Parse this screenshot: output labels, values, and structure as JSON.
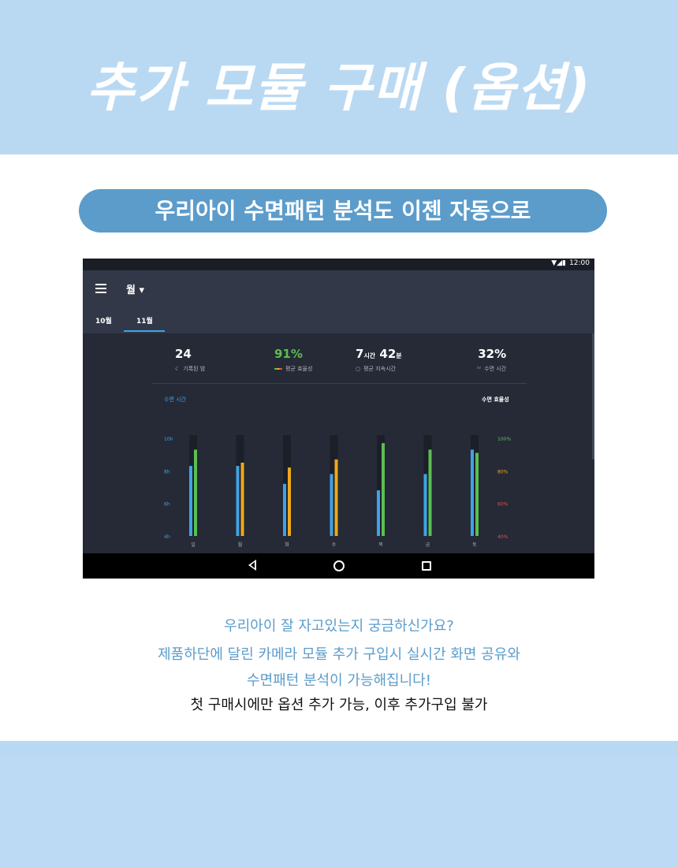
{
  "headline": "추가 모듈 구매 (옵션)",
  "banner": "우리아이 수면패턴 분석도 이젠 자동으로",
  "tablet": {
    "status_time": "12:00",
    "status_icons": "▼◢▮",
    "month_selector": "월 ▾",
    "tabs": [
      "10월",
      "11월"
    ],
    "active_tab": "11월",
    "stats": [
      {
        "value": "24",
        "label": "기록된 밤",
        "icon": "moon-icon"
      },
      {
        "value": "91%",
        "label": "평균 효율성",
        "icon": "efficiency-bar-icon"
      },
      {
        "value_main": "7",
        "unit1": "시간",
        "value_2": "42",
        "unit2": "분",
        "label": "평균 지속시간",
        "icon": "clock-icon"
      },
      {
        "value": "32%",
        "label": "수면 시간",
        "icon": "sleep-icon"
      }
    ],
    "chart_title_left": "수면 시간",
    "chart_title_right": "수면 효율성"
  },
  "chart_data": {
    "type": "bar",
    "categories": [
      "일",
      "월",
      "화",
      "수",
      "목",
      "금",
      "토"
    ],
    "left_axis": {
      "ticks": [
        "10h",
        "8h",
        "6h",
        "4h"
      ],
      "range": [
        4,
        10
      ],
      "color": "#3fa3e6"
    },
    "right_axis": {
      "ticks": [
        "100%",
        "80%",
        "60%",
        "40%"
      ],
      "range": [
        40,
        100
      ],
      "tick_colors": [
        "#5bbf52",
        "#f0a81b",
        "#e05050",
        "#e05050"
      ]
    },
    "series": [
      {
        "name": "수면 시간",
        "axis": "left",
        "color": "#3fa3e6",
        "values": [
          8.3,
          8.3,
          7.2,
          7.8,
          6.8,
          7.8,
          9.3
        ]
      },
      {
        "name": "수면 효율성",
        "axis": "right",
        "values": [
          93,
          85,
          82,
          87,
          97,
          93,
          91
        ],
        "colors": [
          "#5bbf52",
          "#f0a81b",
          "#f0a81b",
          "#f0a81b",
          "#5bbf52",
          "#5bbf52",
          "#5bbf52"
        ]
      }
    ]
  },
  "description": {
    "line1": "우리아이 잘 자고있는지 궁금하신가요?",
    "line2": "제품하단에 달린 카메라 모듈 추가 구입시 실시간 화면 공유와",
    "line3": "수면패턴 분석이 가능해집니다!",
    "line4": "첫 구매시에만 옵션 추가 가능, 이후 추가구입 불가"
  }
}
